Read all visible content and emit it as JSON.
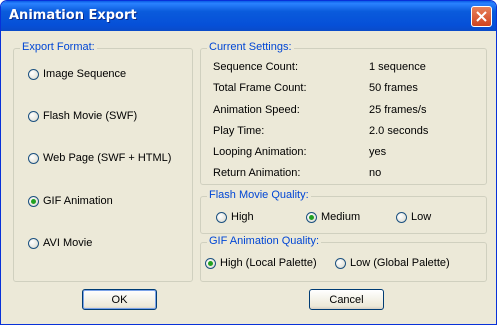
{
  "window": {
    "title": "Animation Export"
  },
  "export_format": {
    "label": "Export Format:",
    "options": [
      {
        "label": "Image Sequence",
        "checked": false
      },
      {
        "label": "Flash Movie (SWF)",
        "checked": false
      },
      {
        "label": "Web Page (SWF + HTML)",
        "checked": false
      },
      {
        "label": "GIF Animation",
        "checked": true
      },
      {
        "label": "AVI Movie",
        "checked": false
      }
    ]
  },
  "current_settings": {
    "label": "Current Settings:",
    "rows": [
      {
        "name": "Sequence Count:",
        "value": "1 sequence"
      },
      {
        "name": "Total Frame Count:",
        "value": "50 frames"
      },
      {
        "name": "Animation Speed:",
        "value": "25 frames/s"
      },
      {
        "name": "Play Time:",
        "value": "2.0 seconds"
      },
      {
        "name": "Looping Animation:",
        "value": "yes"
      },
      {
        "name": "Return Animation:",
        "value": "no"
      }
    ]
  },
  "flash_quality": {
    "label": "Flash Movie Quality:",
    "options": [
      {
        "label": "High",
        "checked": false
      },
      {
        "label": "Medium",
        "checked": true
      },
      {
        "label": "Low",
        "checked": false
      }
    ]
  },
  "gif_quality": {
    "label": "GIF Animation Quality:",
    "options": [
      {
        "label": "High (Local Palette)",
        "checked": true
      },
      {
        "label": "Low (Global Palette)",
        "checked": false
      }
    ]
  },
  "buttons": {
    "ok": "OK",
    "cancel": "Cancel"
  },
  "colors": {
    "title_bar": "#0a5bdc",
    "group_label": "#0046d5",
    "dialog_bg": "#ece9d8",
    "radio_dot": "#21a121",
    "close_button": "#d0431f"
  }
}
